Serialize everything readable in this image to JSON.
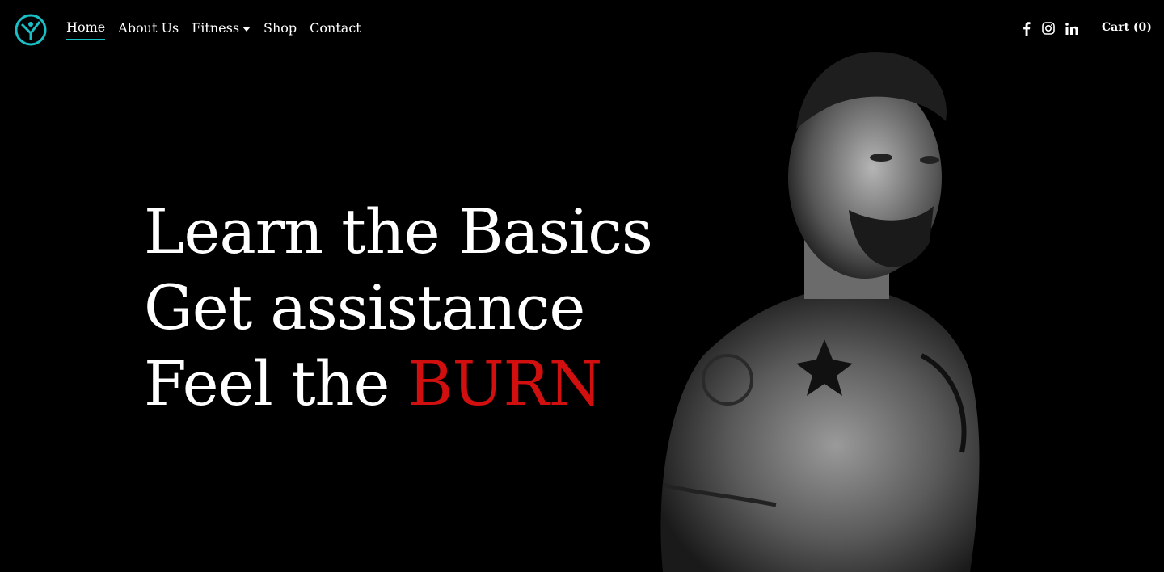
{
  "nav": {
    "items": [
      {
        "label": "Home",
        "active": true
      },
      {
        "label": "About Us"
      },
      {
        "label": "Fitness",
        "has_dropdown": true
      },
      {
        "label": "Shop"
      },
      {
        "label": "Contact"
      }
    ],
    "social_icons": [
      "facebook-icon",
      "instagram-icon",
      "linkedin-icon"
    ],
    "cart_label": "Cart (0)"
  },
  "hero": {
    "line1": "Learn the Basics",
    "line2": "Get assistance",
    "line3_prefix": "Feel the ",
    "line3_highlight": "BURN"
  },
  "colors": {
    "accent": "#19c0c6",
    "highlight": "#d10f0f",
    "background": "#000000"
  }
}
